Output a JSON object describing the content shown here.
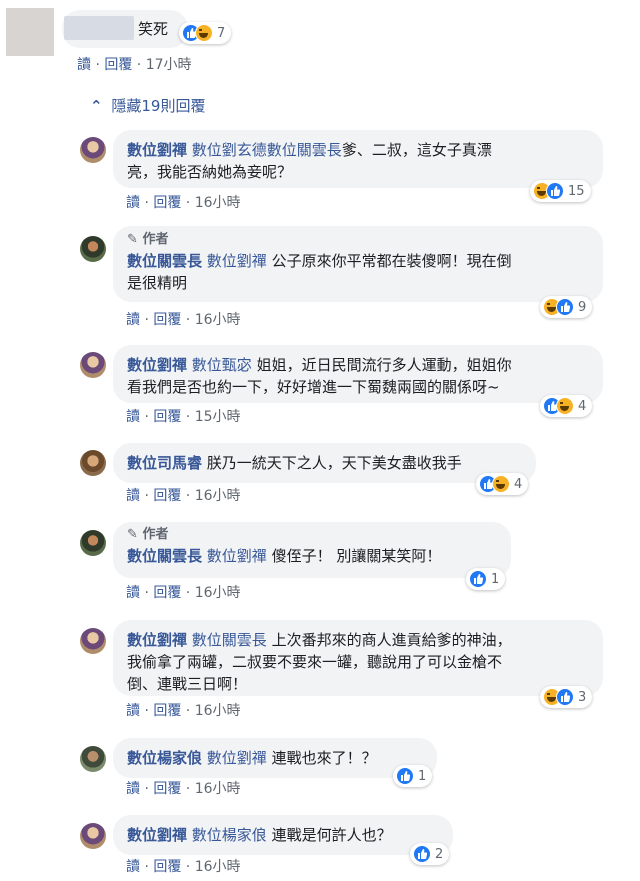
{
  "top_comment": {
    "name": "",
    "text": "笑死",
    "reactions": {
      "icons": [
        "like-icon",
        "haha-icon"
      ],
      "count": "7"
    },
    "actions": {
      "read": "讀",
      "reply": "回覆",
      "time": "17小時"
    }
  },
  "toggle": {
    "label": "隱藏19則回覆"
  },
  "sep": " · ",
  "replies": [
    {
      "name": "數位劉禪",
      "tag": "數位劉玄德數位關雲長",
      "line1": "爹、二叔，這女子真漂",
      "line2": "亮，我能否納她為妾呢？",
      "reaction_count": "15",
      "read": "讀",
      "reply": "回覆",
      "time": "16小時"
    },
    {
      "author_badge": "作者",
      "name": "數位關雲長",
      "tag": "數位劉禪",
      "line1": "公子原來你平常都在裝傻啊！現在倒",
      "line2": "是很精明",
      "reaction_count": "9",
      "read": "讀",
      "reply": "回覆",
      "time": "16小時"
    },
    {
      "name": "數位劉禪",
      "tag": "數位甄宓",
      "line1": "姐姐，近日民間流行多人運動，姐姐你",
      "line2": "看我們是否也約一下，好好增進一下蜀魏兩國的關係呀~",
      "reaction_count": "4",
      "read": "讀",
      "reply": "回覆",
      "time": "15小時"
    },
    {
      "name": "數位司馬睿",
      "tag": "",
      "line1": "朕乃一統天下之人，天下美女盡收我手",
      "reaction_count": "4",
      "read": "讀",
      "reply": "回覆",
      "time": "16小時"
    },
    {
      "author_badge": "作者",
      "name": "數位關雲長",
      "tag": "數位劉禪",
      "line1": "傻侄子！ 別讓關某笑阿！",
      "reaction_count": "1",
      "read": "讀",
      "reply": "回覆",
      "time": "16小時"
    },
    {
      "name": "數位劉禪",
      "tag": "數位關雲長",
      "line1": "上次番邦來的商人進貢給爹的神油，",
      "line2": "我偷拿了兩罐，二叔要不要來一罐，聽說用了可以金槍不",
      "line3": "倒、連戰三日啊！",
      "reaction_count": "3",
      "read": "讀",
      "reply": "回覆",
      "time": "16小時"
    },
    {
      "name": "數位楊家俍",
      "tag": "數位劉禪",
      "line1": "連戰也來了！？",
      "reaction_count": "1",
      "read": "讀",
      "reply": "回覆",
      "time": "16小時"
    },
    {
      "name": "數位劉禪",
      "tag": "數位楊家俍",
      "line1": "連戰是何許人也？",
      "reaction_count": "2",
      "read": "讀",
      "reply": "回覆",
      "time": "16小時"
    }
  ],
  "colors": {
    "link": "#385898",
    "bubble": "#f2f3f5",
    "meta": "#606770",
    "like": "#2078f4",
    "haha": "#f7b125"
  }
}
